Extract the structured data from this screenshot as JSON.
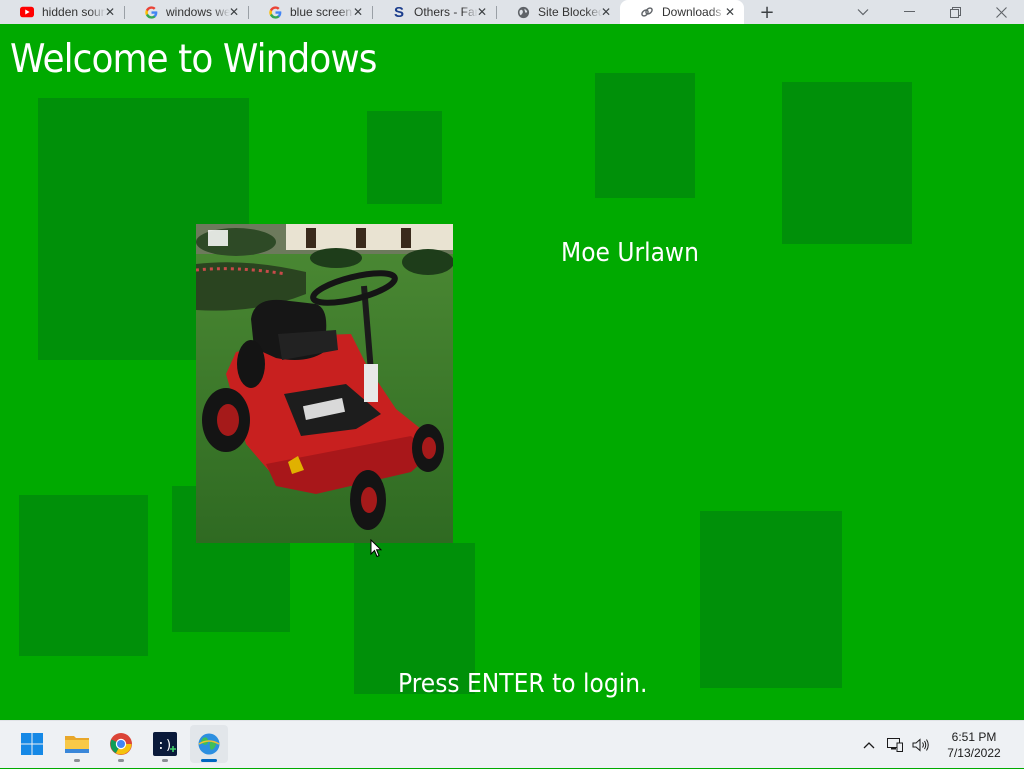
{
  "browser": {
    "tabs": [
      {
        "title": "hidden sounds",
        "icon": "youtube-icon"
      },
      {
        "title": "windows welcome",
        "icon": "google-icon"
      },
      {
        "title": "blue screen",
        "icon": "google-icon"
      },
      {
        "title": "Others - Fandom",
        "icon": "scratch-s-icon"
      },
      {
        "title": "Site Blocked",
        "icon": "globe-icon"
      },
      {
        "title": "Downloads",
        "icon": "link-icon",
        "active": true
      }
    ],
    "new_tab": "+"
  },
  "login": {
    "welcome_title": "Welcome to Windows",
    "username": "Moe Urlawn",
    "prompt": "Press ENTER to login.",
    "user_image": "red riding lawn mower on grass"
  },
  "colors": {
    "background": "#00aa00",
    "squares": "#008c0a"
  },
  "taskbar": {
    "apps": [
      "windows-start-icon",
      "file-explorer-icon",
      "chrome-icon",
      "terminal-icon",
      "globe-app-icon"
    ],
    "time": "6:51 PM",
    "date": "7/13/2022"
  }
}
